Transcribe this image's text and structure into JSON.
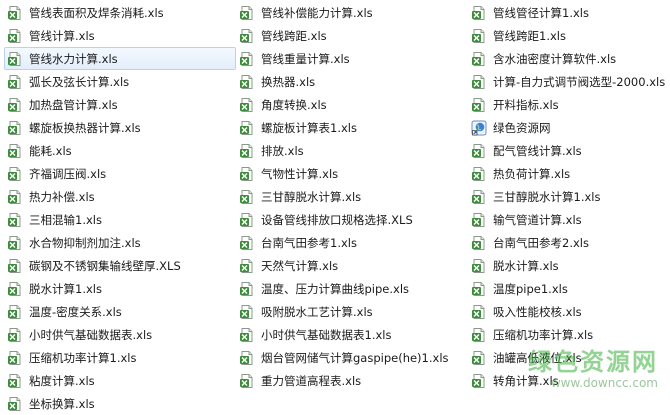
{
  "columns": [
    [
      {
        "label": "管线表面积及焊条消耗.xls",
        "icon": "excel-file-icon"
      },
      {
        "label": "管线计算.xls",
        "icon": "excel-file-icon"
      },
      {
        "label": "管线水力计算.xls",
        "icon": "excel-file-icon",
        "selected": true
      },
      {
        "label": "弧长及弦长计算.xls",
        "icon": "excel-file-icon"
      },
      {
        "label": "加热盘管计算.xls",
        "icon": "excel-file-icon"
      },
      {
        "label": "螺旋板换热器计算.xls",
        "icon": "excel-file-icon"
      },
      {
        "label": "能耗.xls",
        "icon": "excel-file-icon"
      },
      {
        "label": "齐福调压阀.xls",
        "icon": "excel-file-icon"
      },
      {
        "label": "热力补偿.xls",
        "icon": "excel-file-icon"
      },
      {
        "label": "三相混输1.xls",
        "icon": "excel-file-icon"
      },
      {
        "label": "水合物抑制剂加注.xls",
        "icon": "excel-file-icon"
      },
      {
        "label": "碳钢及不锈钢集输线壁厚.XLS",
        "icon": "excel-file-icon"
      },
      {
        "label": "脱水计算1.xls",
        "icon": "excel-file-icon"
      },
      {
        "label": "温度-密度关系.xls",
        "icon": "excel-file-icon"
      },
      {
        "label": "小时供气基础数据表.xls",
        "icon": "excel-file-icon"
      },
      {
        "label": "压缩机功率计算1.xls",
        "icon": "excel-file-icon"
      },
      {
        "label": "粘度计算.xls",
        "icon": "excel-file-icon"
      },
      {
        "label": "坐标换算.xls",
        "icon": "excel-file-icon"
      }
    ],
    [
      {
        "label": "管线补偿能力计算.xls",
        "icon": "excel-file-icon"
      },
      {
        "label": "管线跨距.xls",
        "icon": "excel-file-icon"
      },
      {
        "label": "管线重量计算.xls",
        "icon": "excel-file-icon"
      },
      {
        "label": "换热器.xls",
        "icon": "excel-file-icon"
      },
      {
        "label": "角度转换.xls",
        "icon": "excel-file-icon"
      },
      {
        "label": "螺旋板计算表1.xls",
        "icon": "excel-file-icon"
      },
      {
        "label": "排放.xls",
        "icon": "excel-file-icon"
      },
      {
        "label": "气物性计算.xls",
        "icon": "excel-file-icon"
      },
      {
        "label": "三甘醇脱水计算.xls",
        "icon": "excel-file-icon"
      },
      {
        "label": "设备管线排放口规格选择.XLS",
        "icon": "excel-file-icon"
      },
      {
        "label": "台南气田参考1.xls",
        "icon": "excel-file-icon"
      },
      {
        "label": "天然气计算.xls",
        "icon": "excel-file-icon"
      },
      {
        "label": "温度、压力计算曲线pipe.xls",
        "icon": "excel-file-icon"
      },
      {
        "label": "吸附脱水工艺计算.xls",
        "icon": "excel-file-icon"
      },
      {
        "label": "小时供气基础数据表1.xls",
        "icon": "excel-file-icon"
      },
      {
        "label": "烟台管网储气计算gaspipe(he)1.xls",
        "icon": "excel-file-icon"
      },
      {
        "label": "重力管道高程表.xls",
        "icon": "excel-file-icon"
      }
    ],
    [
      {
        "label": "管线管径计算1.xls",
        "icon": "excel-file-icon"
      },
      {
        "label": "管线跨距1.xls",
        "icon": "excel-file-icon"
      },
      {
        "label": "含水油密度计算软件.xls",
        "icon": "excel-file-icon"
      },
      {
        "label": "计算-自力式调节阀选型-2000.xls",
        "icon": "excel-file-icon"
      },
      {
        "label": "开料指标.xls",
        "icon": "excel-file-icon"
      },
      {
        "label": "绿色资源网",
        "icon": "internet-shortcut-icon"
      },
      {
        "label": "配气管线计算.xls",
        "icon": "excel-file-icon"
      },
      {
        "label": "热负荷计算.xls",
        "icon": "excel-file-icon"
      },
      {
        "label": "三甘醇脱水计算1.xls",
        "icon": "excel-file-icon"
      },
      {
        "label": "输气管道计算.xls",
        "icon": "excel-file-icon"
      },
      {
        "label": "台南气田参考2.xls",
        "icon": "excel-file-icon"
      },
      {
        "label": "脱水计算.xls",
        "icon": "excel-file-icon"
      },
      {
        "label": "温度pipe1.xls",
        "icon": "excel-file-icon"
      },
      {
        "label": "吸入性能校核.xls",
        "icon": "excel-file-icon"
      },
      {
        "label": "压缩机功率计算.xls",
        "icon": "excel-file-icon"
      },
      {
        "label": "油罐高低液位.xls",
        "icon": "excel-file-icon"
      },
      {
        "label": "转角计算.xls",
        "icon": "excel-file-icon"
      }
    ]
  ],
  "watermark": {
    "title": "绿色资源网",
    "url": "www.downcc.com"
  },
  "colors": {
    "excel_green": "#3e8b3e",
    "selection_border": "#b8d2ef",
    "watermark_green": "#3aae3a"
  }
}
